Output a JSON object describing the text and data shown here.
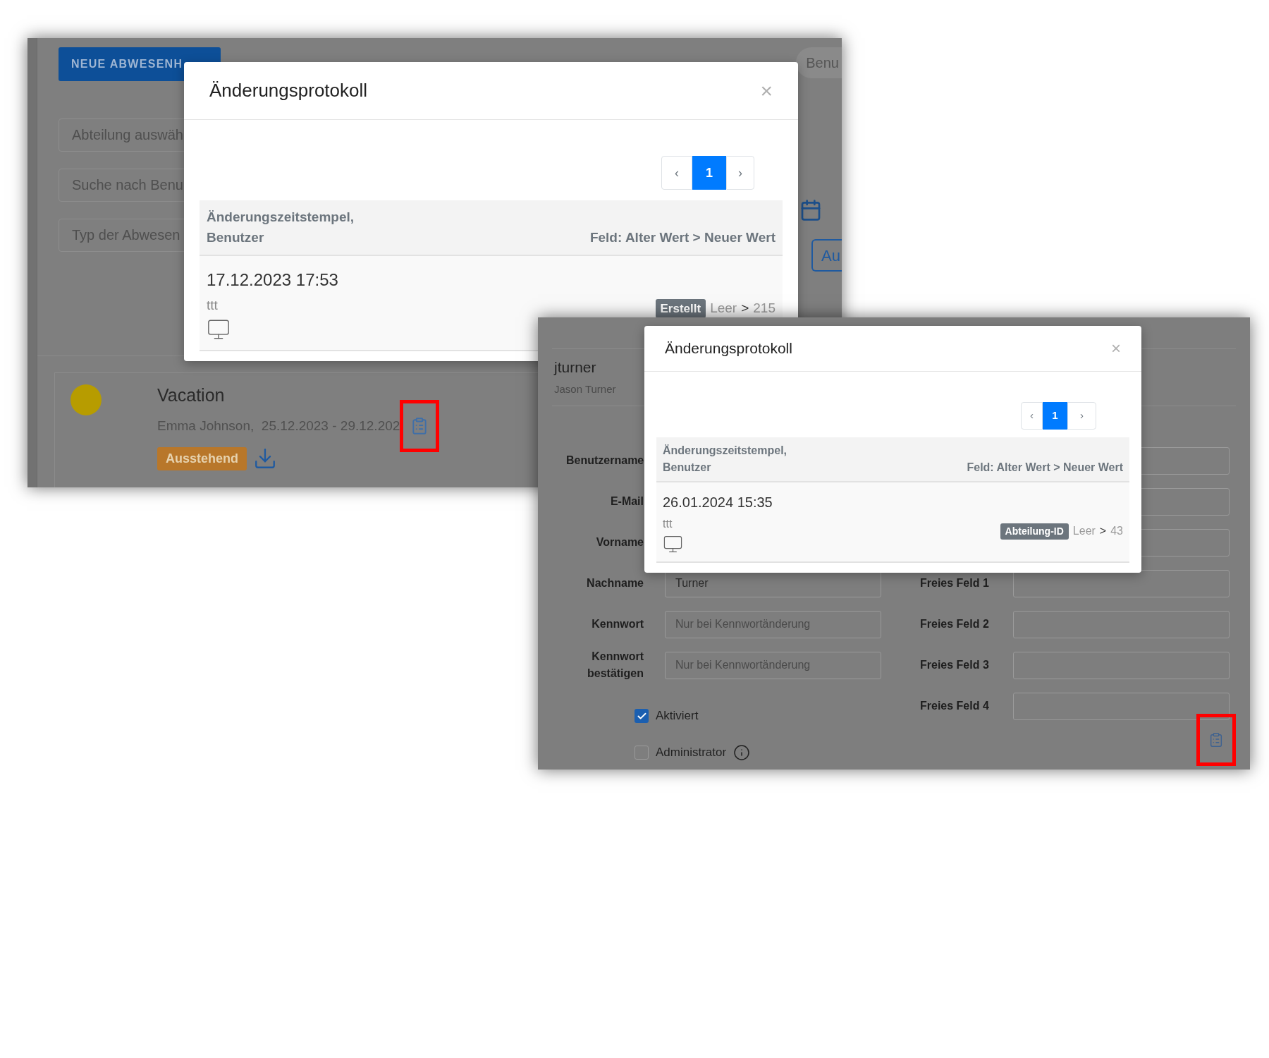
{
  "absence_screen": {
    "new_button": "NEUE ABWESENH",
    "filters": [
      {
        "placeholder": "Abteilung auswäh"
      },
      {
        "placeholder": "Suche nach Benu"
      },
      {
        "placeholder": "Typ der Abwesen"
      }
    ],
    "user_tab": "Benu",
    "side_button": "Au",
    "entry": {
      "title": "Vacation",
      "details": "Emma Johnson,  25.12.2023 - 29.12.202",
      "status": "Ausstehend",
      "highlighted": true
    },
    "modal": {
      "title": "Änderungsprotokoll",
      "close": "×",
      "pages": [
        {
          "label": "‹",
          "selected": false
        },
        {
          "label": "1",
          "selected": true
        },
        {
          "label": "›",
          "selected": false
        }
      ],
      "header_left": [
        "Änderungszeitstempel,",
        "Benutzer"
      ],
      "header_right": "Feld: Alter Wert > Neuer Wert",
      "entries": [
        {
          "timestamp": "17.12.2023 17:53",
          "user": "ttt",
          "field": "Erstellt",
          "old": "Leer",
          "arrow": ">",
          "new": "215"
        }
      ]
    }
  },
  "user_screen": {
    "username": "jturner",
    "full_name": "Jason Turner",
    "left_rows": [
      {
        "label": "Benutzername"
      },
      {
        "label": "E-Mail"
      },
      {
        "label": "Vorname"
      },
      {
        "label": "Nachname",
        "value": "Turner"
      },
      {
        "label": "Kennwort",
        "placeholder": "Nur bei Kennwortänderung"
      },
      {
        "label": "Kennwort bestätigen",
        "placeholder": "Nur bei Kennwortänderung"
      }
    ],
    "right_rows": [
      {
        "label": "Freies Feld 1"
      },
      {
        "label": "Freies Feld 2"
      },
      {
        "label": "Freies Feld 3"
      },
      {
        "label": "Freies Feld 4"
      }
    ],
    "checkboxes": [
      {
        "label": "Aktiviert",
        "checked": true,
        "info": false
      },
      {
        "label": "Administrator",
        "checked": false,
        "info": true
      }
    ],
    "highlighted": true,
    "modal": {
      "title": "Änderungsprotokoll",
      "close": "×",
      "pages": [
        {
          "label": "‹",
          "selected": false
        },
        {
          "label": "1",
          "selected": true
        },
        {
          "label": "›",
          "selected": false
        }
      ],
      "header_left": [
        "Änderungszeitstempel,",
        "Benutzer"
      ],
      "header_right": "Feld: Alter Wert > Neuer Wert",
      "entries": [
        {
          "timestamp": "26.01.2024 15:35",
          "user": "ttt",
          "field": "Abteilung-ID",
          "old": "Leer",
          "arrow": ">",
          "new": "43"
        }
      ]
    }
  }
}
